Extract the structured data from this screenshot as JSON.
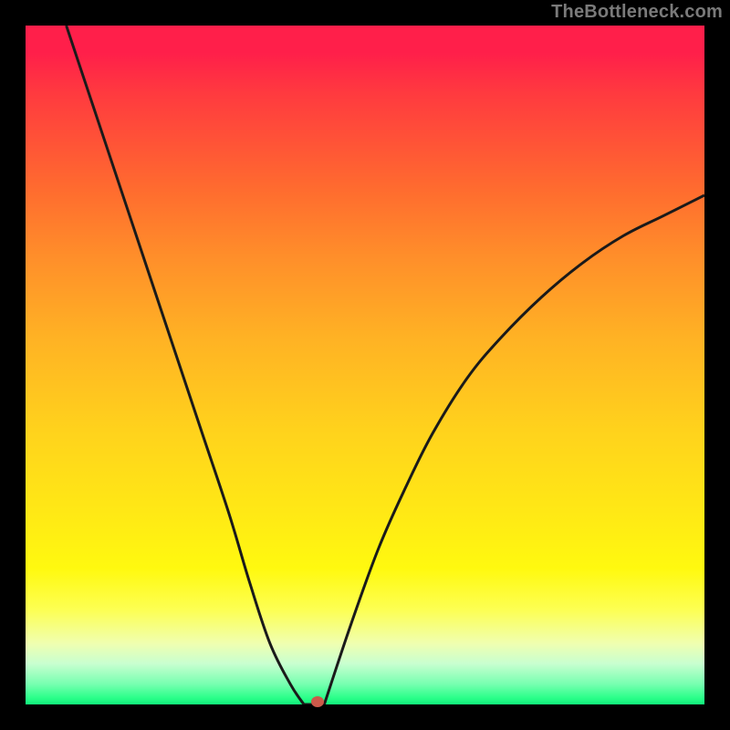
{
  "watermark": "TheBottleneck.com",
  "colors": {
    "frame": "#000000",
    "curve_stroke": "#1a1a1a",
    "dot": "#cc5a4a",
    "watermark_text": "#7a7a7a"
  },
  "chart_data": {
    "type": "line",
    "title": "",
    "xlabel": "",
    "ylabel": "",
    "xlim": [
      0,
      100
    ],
    "ylim": [
      0,
      100
    ],
    "grid": false,
    "series": [
      {
        "name": "left-branch",
        "x": [
          6,
          10,
          14,
          18,
          22,
          26,
          30,
          33,
          36,
          39,
          41
        ],
        "y": [
          100,
          88,
          76,
          64,
          52,
          40,
          28,
          18,
          9,
          3,
          0
        ]
      },
      {
        "name": "right-branch",
        "x": [
          44,
          48,
          52,
          56,
          60,
          65,
          70,
          76,
          82,
          88,
          94,
          100
        ],
        "y": [
          0,
          12,
          23,
          32,
          40,
          48,
          54,
          60,
          65,
          69,
          72,
          75
        ]
      }
    ],
    "annotations": [
      {
        "name": "minimum-marker",
        "x": 43,
        "y": 0
      }
    ]
  }
}
